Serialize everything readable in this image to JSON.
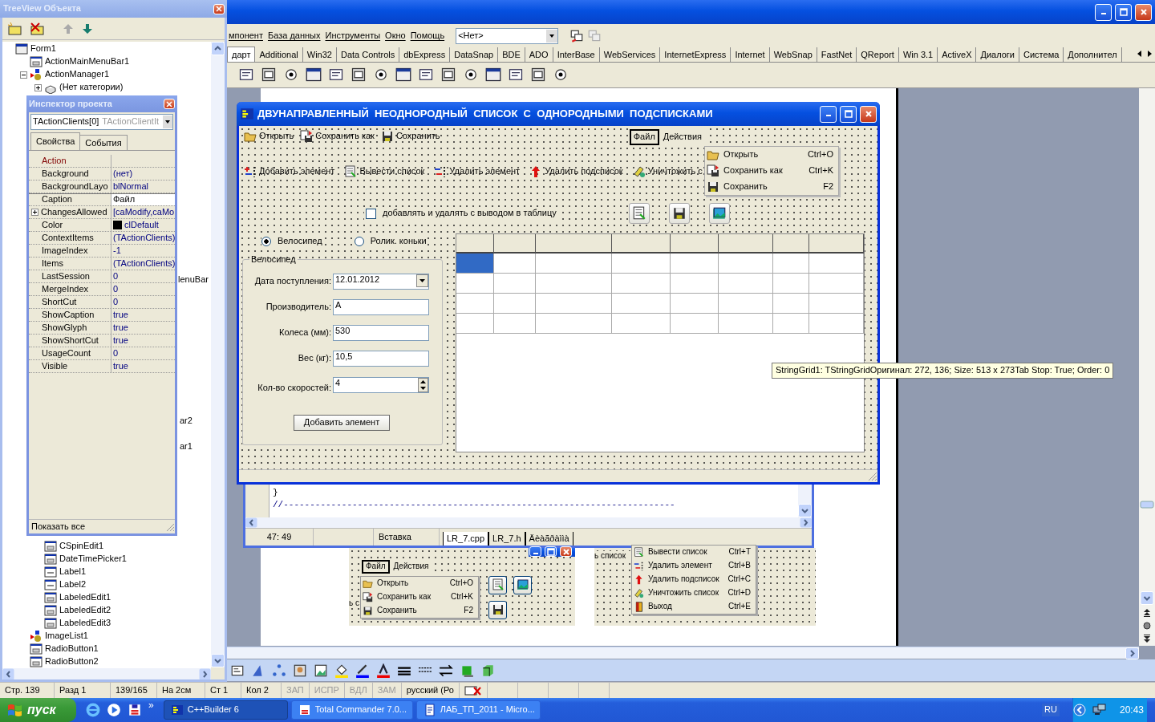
{
  "ide": {
    "menu": [
      "мпонент",
      "База данных",
      "Инструменты",
      "Окно",
      "Помощь"
    ],
    "combo": "<Нет>",
    "palette_tabs": [
      {
        "label": "дарт",
        "selected": true
      },
      {
        "label": "Additional",
        "selected": false
      },
      {
        "label": "Win32",
        "selected": false
      },
      {
        "label": "Data Controls",
        "selected": false
      },
      {
        "label": "dbExpress",
        "selected": false
      },
      {
        "label": "DataSnap",
        "selected": false
      },
      {
        "label": "BDE",
        "selected": false
      },
      {
        "label": "ADO",
        "selected": false
      },
      {
        "label": "InterBase",
        "selected": false
      },
      {
        "label": "WebServices",
        "selected": false
      },
      {
        "label": "InternetExpress",
        "selected": false
      },
      {
        "label": "Internet",
        "selected": false
      },
      {
        "label": "WebSnap",
        "selected": false
      },
      {
        "label": "FastNet",
        "selected": false
      },
      {
        "label": "QReport",
        "selected": false
      },
      {
        "label": "Win 3.1",
        "selected": false
      },
      {
        "label": "ActiveX",
        "selected": false
      },
      {
        "label": "Диалоги",
        "selected": false
      },
      {
        "label": "Система",
        "selected": false
      },
      {
        "label": "Дополнител",
        "selected": false
      }
    ]
  },
  "treeview": {
    "title": "TreeView Объекта",
    "upper": [
      {
        "label": "Form1",
        "kind": "form",
        "children": [
          {
            "label": "ActionMainMenuBar1",
            "kind": "control"
          },
          {
            "label": "ActionManager1",
            "kind": "manager",
            "expanded": true,
            "children": [
              {
                "label": "(Нет категории)",
                "kind": "category",
                "expanded": false
              }
            ]
          }
        ]
      }
    ],
    "fragments": [
      "lenuBar",
      "ar2",
      "ar1"
    ],
    "lower_nested": [
      {
        "label": "CSpinEdit1",
        "kind": "control"
      },
      {
        "label": "DateTimePicker1",
        "kind": "control"
      },
      {
        "label": "Label1",
        "kind": "label"
      },
      {
        "label": "Label2",
        "kind": "label"
      },
      {
        "label": "LabeledEdit1",
        "kind": "control"
      },
      {
        "label": "LabeledEdit2",
        "kind": "control"
      },
      {
        "label": "LabeledEdit3",
        "kind": "control"
      }
    ],
    "lower": [
      {
        "label": "ImageList1",
        "kind": "manager"
      },
      {
        "label": "RadioButton1",
        "kind": "control"
      },
      {
        "label": "RadioButton2",
        "kind": "control"
      }
    ]
  },
  "inspector": {
    "title": "Инспектор проекта",
    "object": "TActionClients[0]",
    "object_type": "TActionClientIt",
    "tabs": [
      {
        "label": "Свойства",
        "selected": true
      },
      {
        "label": "События",
        "selected": false
      }
    ],
    "properties": [
      {
        "name": "Action",
        "kind": "link",
        "selected": false
      },
      {
        "name": "Background",
        "value": "(нет)",
        "kind": "text",
        "selected": false
      },
      {
        "name": "BackgroundLayo",
        "value": "blNormal",
        "kind": "text",
        "selected": false
      },
      {
        "name": "Caption",
        "value": "Файл",
        "kind": "text",
        "selected": true
      },
      {
        "name": "ChangesAllowed",
        "value": "[caModify,caMo",
        "kind": "set",
        "selected": false
      },
      {
        "name": "Color",
        "value": "clDefault",
        "kind": "color",
        "selected": false
      },
      {
        "name": "ContextItems",
        "value": "(TActionClients)",
        "kind": "text",
        "selected": false
      },
      {
        "name": "ImageIndex",
        "value": "-1",
        "kind": "text",
        "selected": false
      },
      {
        "name": "Items",
        "value": "(TActionClients)",
        "kind": "text",
        "selected": false
      },
      {
        "name": "LastSession",
        "value": "0",
        "kind": "text",
        "selected": false
      },
      {
        "name": "MergeIndex",
        "value": "0",
        "kind": "text",
        "selected": false
      },
      {
        "name": "ShortCut",
        "value": "0",
        "kind": "text",
        "selected": false
      },
      {
        "name": "ShowCaption",
        "value": "true",
        "kind": "text",
        "selected": false
      },
      {
        "name": "ShowGlyph",
        "value": "true",
        "kind": "text",
        "selected": false
      },
      {
        "name": "ShowShortCut",
        "value": "true",
        "kind": "text",
        "selected": false
      },
      {
        "name": "UsageCount",
        "value": "0",
        "kind": "text",
        "selected": false
      },
      {
        "name": "Visible",
        "value": "true",
        "kind": "text",
        "selected": false
      }
    ],
    "footer": "Показать все"
  },
  "form": {
    "title": "ДВУНАПРАВЛЕННЫЙ  НЕОДНОРОДНЫЙ  СПИСОК  С  ОДНОРОДНЫМИ  ПОДСПИСКАМИ",
    "toolbar": [
      {
        "label": "Открыть",
        "kind": "open"
      },
      {
        "label": "Сохранить как",
        "kind": "saveas"
      },
      {
        "label": "Сохранить",
        "kind": "save"
      }
    ],
    "menu_bar": [
      {
        "label": "Файл",
        "selected": true
      },
      {
        "label": "Действия",
        "selected": false
      }
    ],
    "menu": [
      {
        "label": "Открыть",
        "shortcut": "Ctrl+O",
        "kind": "open"
      },
      {
        "label": "Сохранить как",
        "shortcut": "Ctrl+K",
        "kind": "saveas"
      },
      {
        "label": "Сохранить",
        "shortcut": "F2",
        "kind": "save"
      }
    ],
    "actions": [
      {
        "label": "Добавить элемент",
        "kind": "add"
      },
      {
        "label": "Вывести список",
        "kind": "print"
      },
      {
        "label": "Удалить элемент",
        "kind": "remove"
      },
      {
        "label": "Удалить подсписок",
        "kind": "removesub"
      },
      {
        "label": "Уничтожить с",
        "kind": "destroy"
      }
    ],
    "checkbox": {
      "label": "добавлять и удалять с выводом в таблицу",
      "checked": false
    },
    "icon_buttons": [
      {
        "kind": "print"
      },
      {
        "kind": "save"
      },
      {
        "kind": "picture"
      }
    ],
    "radios": [
      {
        "label": "Велосипед",
        "selected": true
      },
      {
        "label": "Ролик. коньки",
        "selected": false
      }
    ],
    "group": "Велосипед",
    "fields": [
      {
        "label": "Дата поступления:",
        "value": "12.01.2012",
        "kind": "combo"
      },
      {
        "label": "Производитель:",
        "value": "A",
        "kind": "text"
      },
      {
        "label": "Колеса (мм):",
        "value": "530",
        "kind": "text"
      },
      {
        "label": "Вес (кг):",
        "value": "10,5",
        "kind": "text"
      },
      {
        "label": "Кол-во скоростей:",
        "value": "4",
        "kind": "spin"
      }
    ],
    "add_button": "Добавить элемент",
    "grid": {
      "rows": [
        {
          "cells": [
            {
              "selected": true
            },
            {
              "selected": false
            },
            {
              "selected": false
            },
            {
              "selected": false
            },
            {
              "selected": false
            },
            {
              "selected": false
            },
            {
              "selected": false
            },
            {
              "selected": false
            }
          ]
        },
        {
          "cells": [
            {
              "selected": false
            },
            {
              "selected": false
            },
            {
              "selected": false
            },
            {
              "selected": false
            },
            {
              "selected": false
            },
            {
              "selected": false
            },
            {
              "selected": false
            },
            {
              "selected": false
            }
          ]
        },
        {
          "cells": [
            {
              "selected": false
            },
            {
              "selected": false
            },
            {
              "selected": false
            },
            {
              "selected": false
            },
            {
              "selected": false
            },
            {
              "selected": false
            },
            {
              "selected": false
            },
            {
              "selected": false
            }
          ]
        },
        {
          "cells": [
            {
              "selected": false
            },
            {
              "selected": false
            },
            {
              "selected": false
            },
            {
              "selected": false
            },
            {
              "selected": false
            },
            {
              "selected": false
            },
            {
              "selected": false
            },
            {
              "selected": false
            }
          ]
        }
      ]
    }
  },
  "tooltip": "StringGrid1: TStringGridОригинал: 272, 136; Size: 513 x 273Tab Stop: True; Order: 0",
  "editor": {
    "lines": [
      "}",
      "//--------------------------------------------------------------------------"
    ],
    "position": "47:  49",
    "mode": "Вставка",
    "tabs": [
      {
        "label": "LR_7.cpp",
        "selected": true
      },
      {
        "label": "LR_7.h",
        "selected": false
      },
      {
        "label": "Äèàãðàììà",
        "selected": false
      }
    ]
  },
  "doc_left": {
    "menu_bar": [
      {
        "label": "Файл",
        "selected": true
      },
      {
        "label": "Действия",
        "selected": false
      }
    ],
    "fragment": "ь с",
    "menu": [
      {
        "label": "Открыть",
        "shortcut": "Ctrl+O",
        "kind": "open"
      },
      {
        "label": "Сохранить как",
        "shortcut": "Ctrl+K",
        "kind": "saveas"
      },
      {
        "label": "Сохранить",
        "shortcut": "F2",
        "kind": "save"
      }
    ]
  },
  "doc_right": {
    "fragment": "ь список",
    "menu": [
      {
        "label": "Вывести список",
        "shortcut": "Ctrl+T",
        "kind": "print"
      },
      {
        "label": "Удалить элемент",
        "shortcut": "Ctrl+B",
        "kind": "remove"
      },
      {
        "label": "Удалить подсписок",
        "shortcut": "Ctrl+C",
        "kind": "removesub"
      },
      {
        "label": "Уничтожить список",
        "shortcut": "Ctrl+D",
        "kind": "destroy"
      },
      {
        "label": "Выход",
        "shortcut": "Ctrl+E",
        "kind": "exit"
      }
    ]
  },
  "word_status": {
    "fields": [
      "Стр. 139",
      "Разд 1",
      "139/165",
      "На 2см",
      "Ст 1",
      "Кол 2"
    ],
    "indicators": [
      {
        "label": "ЗАП",
        "disabled": true
      },
      {
        "label": "ИСПР",
        "disabled": true
      },
      {
        "label": "ВДЛ",
        "disabled": true
      },
      {
        "label": "ЗАМ",
        "disabled": true
      }
    ],
    "language": "русский (Ро"
  },
  "taskbar": {
    "start": "пуск",
    "more": "»",
    "tasks": [
      {
        "label": "C++Builder 6",
        "selected": true,
        "kind": "builder"
      },
      {
        "label": "Total Commander 7.0...",
        "selected": false,
        "kind": "commander"
      },
      {
        "label": "ЛАБ_ТП_2011 - Micro...",
        "selected": false,
        "kind": "word"
      }
    ],
    "language": "RU",
    "time": "20:43"
  }
}
